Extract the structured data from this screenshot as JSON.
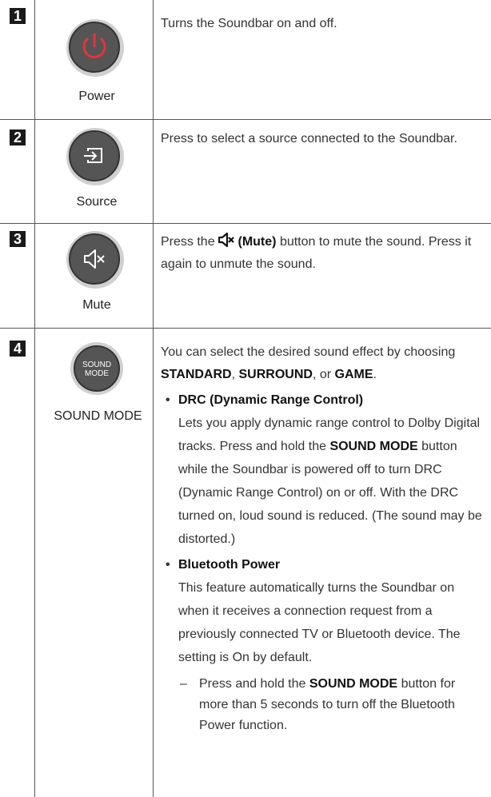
{
  "rows": [
    {
      "number": "1",
      "icon": "power-icon",
      "label": "Power",
      "description": "Turns the Soundbar on and off."
    },
    {
      "number": "2",
      "icon": "source-input-icon",
      "label": "Source",
      "description": "Press to select a source connected to the Soundbar."
    },
    {
      "number": "3",
      "icon": "mute-icon",
      "label": "Mute",
      "desc_pre": "Press the",
      "desc_bold": "(Mute)",
      "desc_post": "button to mute the sound. Press it again to unmute the sound."
    },
    {
      "number": "4",
      "icon": "sound-mode-icon",
      "icon_text_line1": "SOUND",
      "icon_text_line2": "MODE",
      "label": "SOUND MODE",
      "intro_pre": "You can select the desired sound effect by choosing",
      "intro_opt1": "STANDARD",
      "intro_sep1": ",",
      "intro_opt2": "SURROUND",
      "intro_sep2": ", or",
      "intro_opt3": "GAME",
      "intro_end": ".",
      "bullet1_title": "DRC (Dynamic Range Control)",
      "bullet1_text_pre": "Lets you apply dynamic range control to Dolby Digital tracks. Press and hold the",
      "bullet1_text_bold": "SOUND MODE",
      "bullet1_text_post": "button while the Soundbar is powered off to turn DRC (Dynamic Range Control) on or off. With the DRC turned on, loud sound is reduced. (The sound may be distorted.)",
      "bullet2_title": "Bluetooth Power",
      "bullet2_text": "This feature automatically turns the Soundbar on when it receives a connection request from a previously connected TV or Bluetooth device. The setting is On by default.",
      "sub_pre": "Press and hold the",
      "sub_bold": "SOUND MODE",
      "sub_post": "button for more than 5 seconds to turn off the Bluetooth Power function."
    }
  ],
  "colors": {
    "power_red": "#e8333a",
    "button_fill": "#555555",
    "button_ring": "#d0d0d0",
    "number_bg": "#1a1a1a"
  }
}
